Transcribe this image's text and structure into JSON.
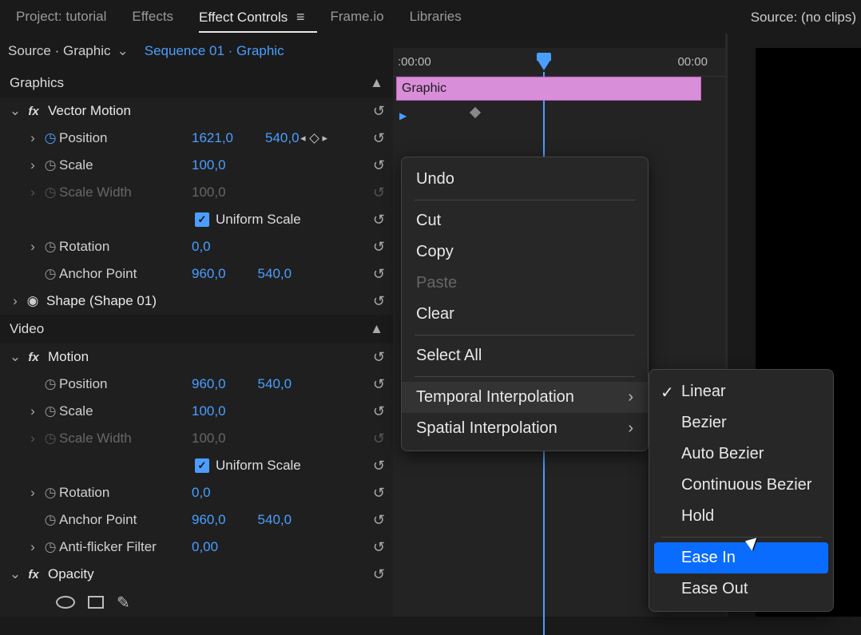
{
  "tabs": {
    "project": "Project: tutorial",
    "effects": "Effects",
    "effect_controls": "Effect Controls",
    "frameio": "Frame.io",
    "libraries": "Libraries"
  },
  "breadcrumb": {
    "source": "Source · Graphic",
    "sequence": "Sequence 01 · Graphic"
  },
  "source_panel": "Source: (no clips)",
  "sections": {
    "graphics": "Graphics",
    "video": "Video"
  },
  "groups": {
    "vector_motion": "Vector Motion",
    "shape": "Shape (Shape 01)",
    "motion": "Motion",
    "opacity": "Opacity"
  },
  "props": {
    "position": "Position",
    "scale": "Scale",
    "scale_width": "Scale Width",
    "uniform_scale": "Uniform Scale",
    "rotation": "Rotation",
    "anchor_point": "Anchor Point",
    "anti_flicker": "Anti-flicker Filter"
  },
  "values": {
    "vm_position_x": "1621,0",
    "vm_position_y": "540,0",
    "vm_scale": "100,0",
    "vm_scale_width": "100,0",
    "vm_rotation": "0,0",
    "vm_anchor_x": "960,0",
    "vm_anchor_y": "540,0",
    "m_position_x": "960,0",
    "m_position_y": "540,0",
    "m_scale": "100,0",
    "m_scale_width": "100,0",
    "m_rotation": "0,0",
    "m_anchor_x": "960,0",
    "m_anchor_y": "540,0",
    "anti_flicker": "0,00"
  },
  "timeline": {
    "time_start": ":00:00",
    "time_end": "00:00",
    "clip_name": "Graphic"
  },
  "context_menu": {
    "undo": "Undo",
    "cut": "Cut",
    "copy": "Copy",
    "paste": "Paste",
    "clear": "Clear",
    "select_all": "Select All",
    "temporal": "Temporal Interpolation",
    "spatial": "Spatial Interpolation"
  },
  "submenu": {
    "linear": "Linear",
    "bezier": "Bezier",
    "auto_bezier": "Auto Bezier",
    "continuous_bezier": "Continuous Bezier",
    "hold": "Hold",
    "ease_in": "Ease In",
    "ease_out": "Ease Out"
  }
}
